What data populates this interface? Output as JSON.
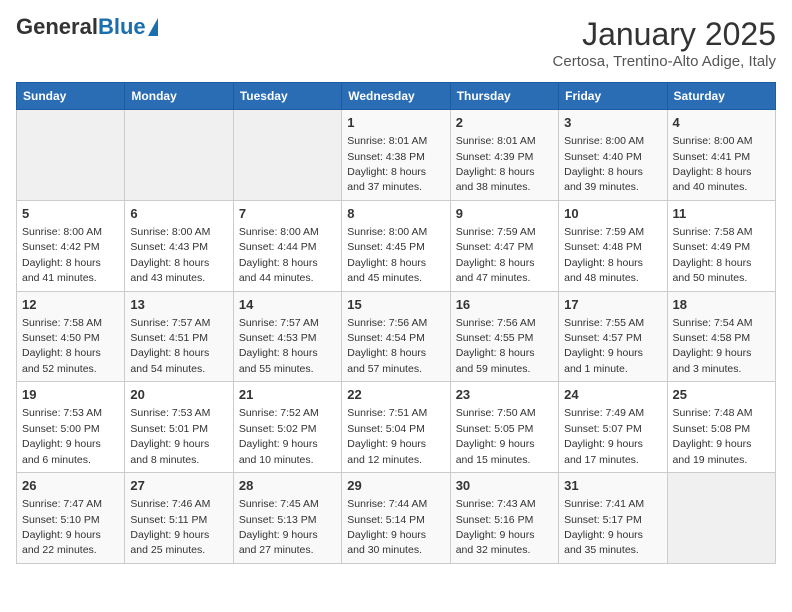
{
  "logo": {
    "general": "General",
    "blue": "Blue"
  },
  "header": {
    "title": "January 2025",
    "subtitle": "Certosa, Trentino-Alto Adige, Italy"
  },
  "weekdays": [
    "Sunday",
    "Monday",
    "Tuesday",
    "Wednesday",
    "Thursday",
    "Friday",
    "Saturday"
  ],
  "weeks": [
    [
      {
        "day": null,
        "info": null
      },
      {
        "day": null,
        "info": null
      },
      {
        "day": null,
        "info": null
      },
      {
        "day": "1",
        "info": "Sunrise: 8:01 AM\nSunset: 4:38 PM\nDaylight: 8 hours and 37 minutes."
      },
      {
        "day": "2",
        "info": "Sunrise: 8:01 AM\nSunset: 4:39 PM\nDaylight: 8 hours and 38 minutes."
      },
      {
        "day": "3",
        "info": "Sunrise: 8:00 AM\nSunset: 4:40 PM\nDaylight: 8 hours and 39 minutes."
      },
      {
        "day": "4",
        "info": "Sunrise: 8:00 AM\nSunset: 4:41 PM\nDaylight: 8 hours and 40 minutes."
      }
    ],
    [
      {
        "day": "5",
        "info": "Sunrise: 8:00 AM\nSunset: 4:42 PM\nDaylight: 8 hours and 41 minutes."
      },
      {
        "day": "6",
        "info": "Sunrise: 8:00 AM\nSunset: 4:43 PM\nDaylight: 8 hours and 43 minutes."
      },
      {
        "day": "7",
        "info": "Sunrise: 8:00 AM\nSunset: 4:44 PM\nDaylight: 8 hours and 44 minutes."
      },
      {
        "day": "8",
        "info": "Sunrise: 8:00 AM\nSunset: 4:45 PM\nDaylight: 8 hours and 45 minutes."
      },
      {
        "day": "9",
        "info": "Sunrise: 7:59 AM\nSunset: 4:47 PM\nDaylight: 8 hours and 47 minutes."
      },
      {
        "day": "10",
        "info": "Sunrise: 7:59 AM\nSunset: 4:48 PM\nDaylight: 8 hours and 48 minutes."
      },
      {
        "day": "11",
        "info": "Sunrise: 7:58 AM\nSunset: 4:49 PM\nDaylight: 8 hours and 50 minutes."
      }
    ],
    [
      {
        "day": "12",
        "info": "Sunrise: 7:58 AM\nSunset: 4:50 PM\nDaylight: 8 hours and 52 minutes."
      },
      {
        "day": "13",
        "info": "Sunrise: 7:57 AM\nSunset: 4:51 PM\nDaylight: 8 hours and 54 minutes."
      },
      {
        "day": "14",
        "info": "Sunrise: 7:57 AM\nSunset: 4:53 PM\nDaylight: 8 hours and 55 minutes."
      },
      {
        "day": "15",
        "info": "Sunrise: 7:56 AM\nSunset: 4:54 PM\nDaylight: 8 hours and 57 minutes."
      },
      {
        "day": "16",
        "info": "Sunrise: 7:56 AM\nSunset: 4:55 PM\nDaylight: 8 hours and 59 minutes."
      },
      {
        "day": "17",
        "info": "Sunrise: 7:55 AM\nSunset: 4:57 PM\nDaylight: 9 hours and 1 minute."
      },
      {
        "day": "18",
        "info": "Sunrise: 7:54 AM\nSunset: 4:58 PM\nDaylight: 9 hours and 3 minutes."
      }
    ],
    [
      {
        "day": "19",
        "info": "Sunrise: 7:53 AM\nSunset: 5:00 PM\nDaylight: 9 hours and 6 minutes."
      },
      {
        "day": "20",
        "info": "Sunrise: 7:53 AM\nSunset: 5:01 PM\nDaylight: 9 hours and 8 minutes."
      },
      {
        "day": "21",
        "info": "Sunrise: 7:52 AM\nSunset: 5:02 PM\nDaylight: 9 hours and 10 minutes."
      },
      {
        "day": "22",
        "info": "Sunrise: 7:51 AM\nSunset: 5:04 PM\nDaylight: 9 hours and 12 minutes."
      },
      {
        "day": "23",
        "info": "Sunrise: 7:50 AM\nSunset: 5:05 PM\nDaylight: 9 hours and 15 minutes."
      },
      {
        "day": "24",
        "info": "Sunrise: 7:49 AM\nSunset: 5:07 PM\nDaylight: 9 hours and 17 minutes."
      },
      {
        "day": "25",
        "info": "Sunrise: 7:48 AM\nSunset: 5:08 PM\nDaylight: 9 hours and 19 minutes."
      }
    ],
    [
      {
        "day": "26",
        "info": "Sunrise: 7:47 AM\nSunset: 5:10 PM\nDaylight: 9 hours and 22 minutes."
      },
      {
        "day": "27",
        "info": "Sunrise: 7:46 AM\nSunset: 5:11 PM\nDaylight: 9 hours and 25 minutes."
      },
      {
        "day": "28",
        "info": "Sunrise: 7:45 AM\nSunset: 5:13 PM\nDaylight: 9 hours and 27 minutes."
      },
      {
        "day": "29",
        "info": "Sunrise: 7:44 AM\nSunset: 5:14 PM\nDaylight: 9 hours and 30 minutes."
      },
      {
        "day": "30",
        "info": "Sunrise: 7:43 AM\nSunset: 5:16 PM\nDaylight: 9 hours and 32 minutes."
      },
      {
        "day": "31",
        "info": "Sunrise: 7:41 AM\nSunset: 5:17 PM\nDaylight: 9 hours and 35 minutes."
      },
      {
        "day": null,
        "info": null
      }
    ]
  ]
}
